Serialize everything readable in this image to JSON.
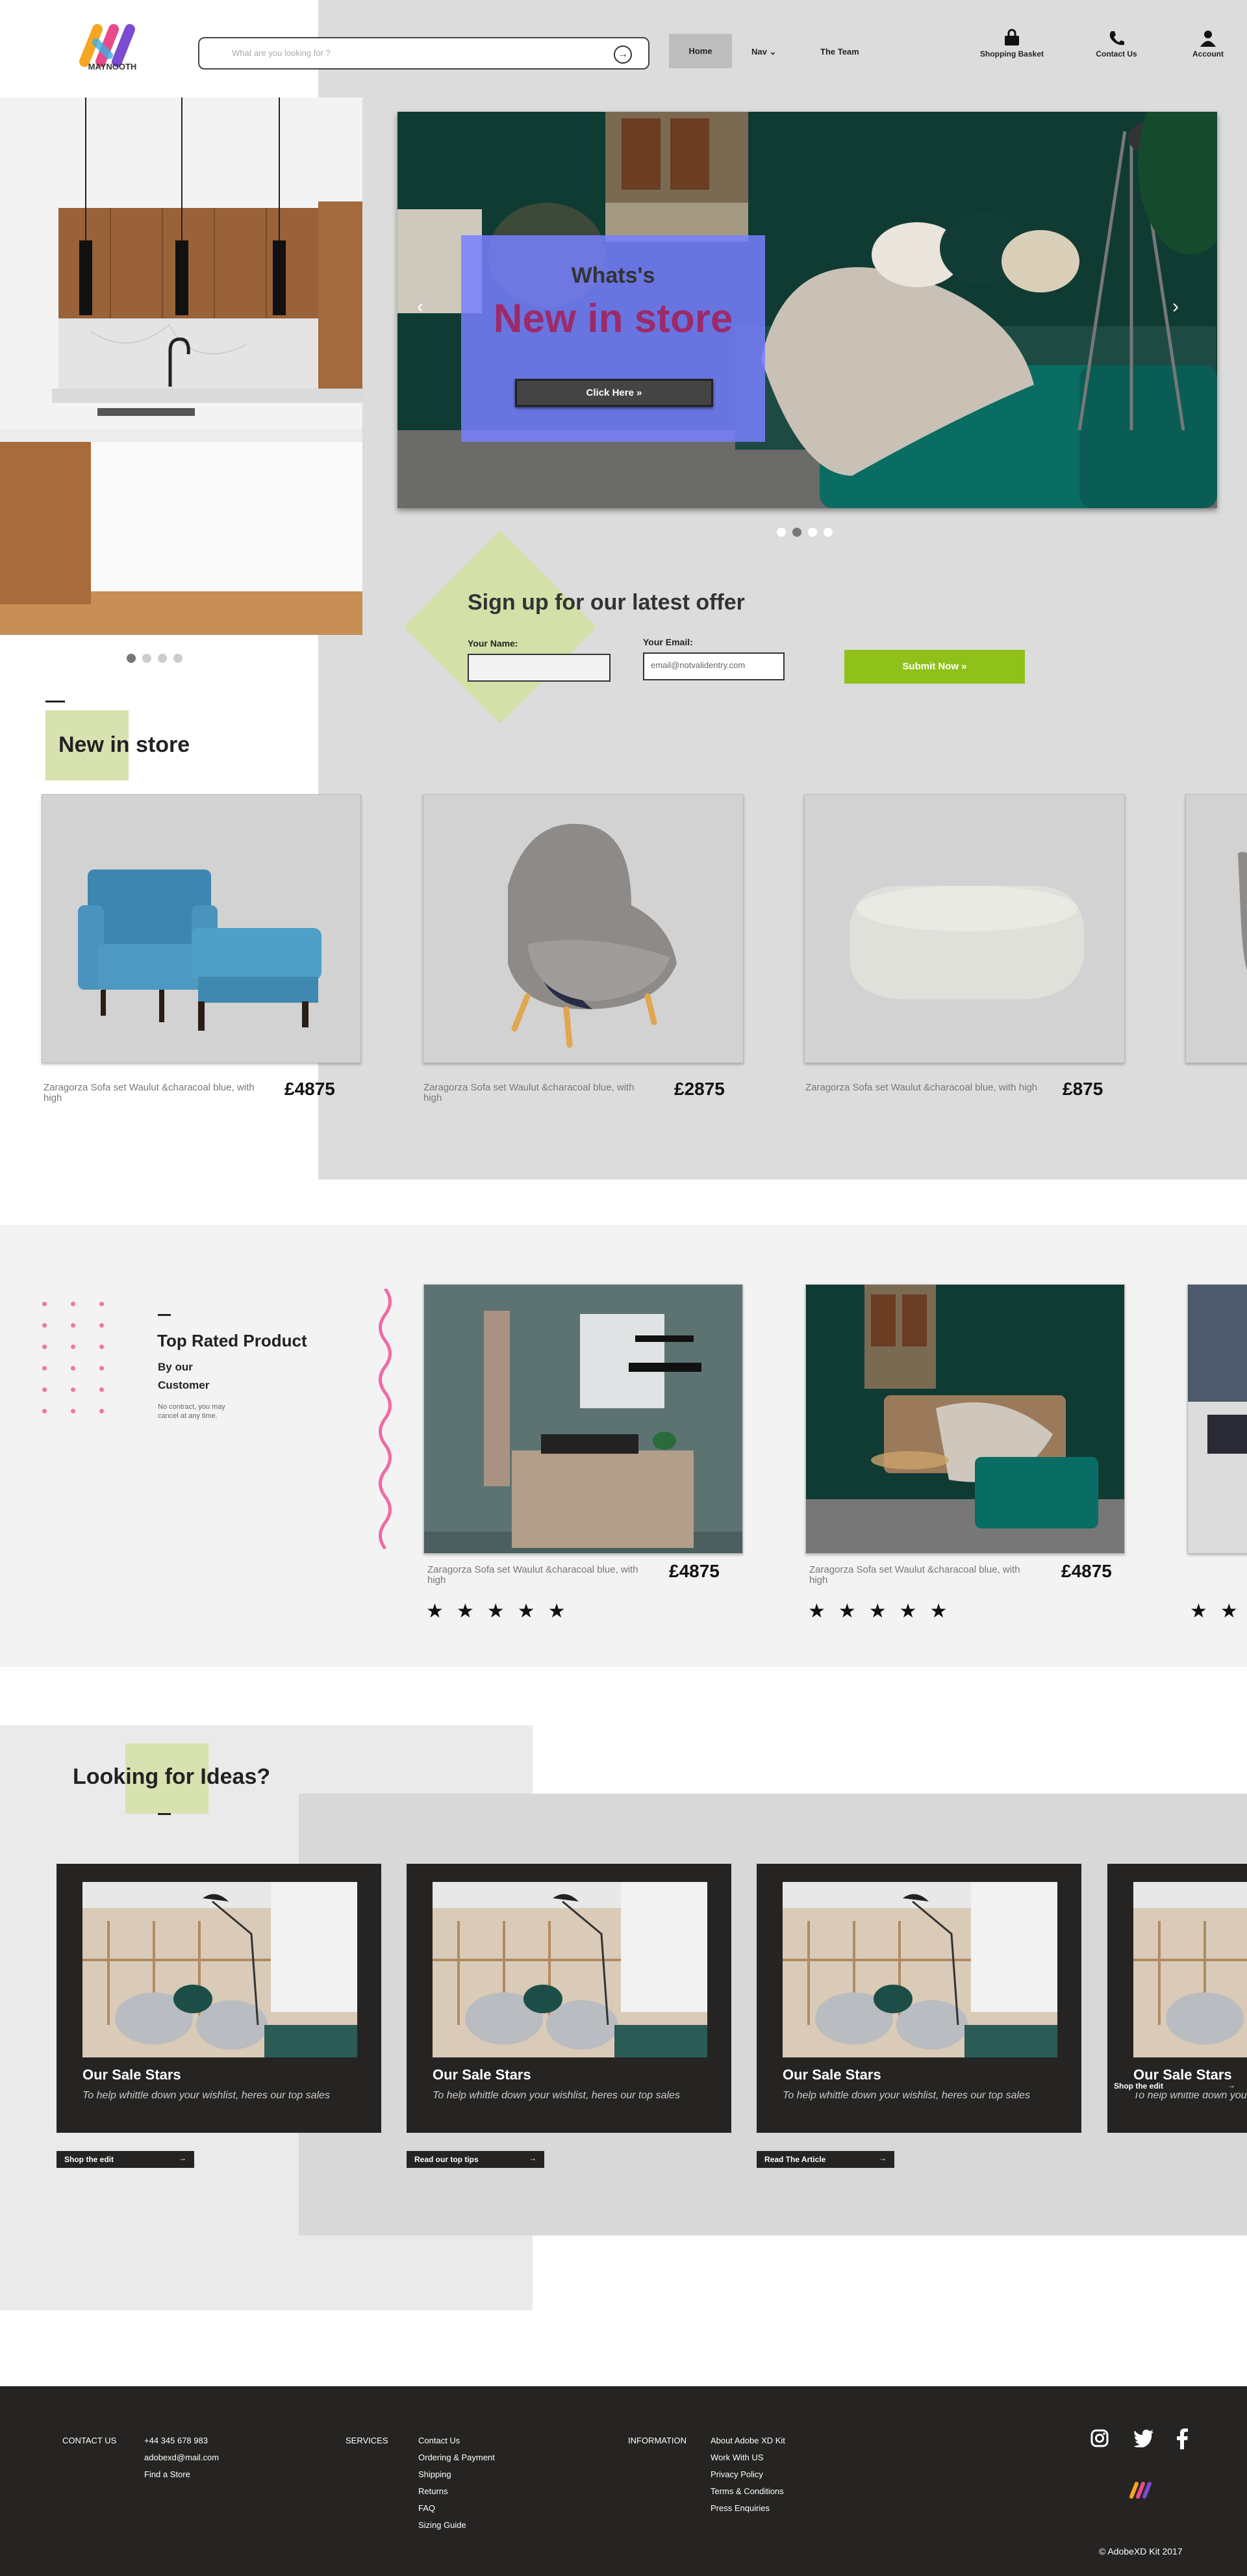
{
  "header": {
    "logo_text": "MAYNOOTH",
    "search_placeholder": "What are you looking for ?",
    "nav": {
      "home": "Home",
      "nav": "Nav",
      "team": "The Team"
    },
    "icons": [
      {
        "label": "Shopping Basket",
        "icon": "basket-icon"
      },
      {
        "label": "Contact Us",
        "icon": "phone-icon"
      },
      {
        "label": "Account",
        "icon": "account-icon"
      }
    ]
  },
  "hero": {
    "whats": "Whats's",
    "title": "New in store",
    "button": "Click Here  »",
    "slides": 4,
    "active_slide": 2
  },
  "kitchen_carousel": {
    "slides": 4,
    "active_slide": 1
  },
  "signup": {
    "title": "Sign up for our latest offer",
    "name_label": "Your Name:",
    "email_label": "Your Email:",
    "email_placeholder": "email@notvalidentry.com",
    "submit": "Submit Now »"
  },
  "new_in_store": {
    "title": "New in store",
    "products": [
      {
        "desc": "Zaragorza Sofa set Waulut &characoal blue, with high",
        "price": "£4875"
      },
      {
        "desc": "Zaragorza Sofa set Waulut &characoal blue, with high",
        "price": "£2875"
      },
      {
        "desc": "Zaragorza Sofa set Waulut &characoal blue, with high",
        "price": "£875"
      }
    ]
  },
  "top_rated": {
    "title": "Top Rated Product",
    "by": "By our",
    "customer": "Customer",
    "note": "No contract, you may cancel at any time.",
    "products": [
      {
        "desc": "Zaragorza Sofa set Waulut &characoal blue, with high",
        "price": "£4875",
        "stars": 5
      },
      {
        "desc": "Zaragorza Sofa set Waulut &characoal blue, with high",
        "price": "£4875",
        "stars": 5
      }
    ]
  },
  "ideas": {
    "title": "Looking for Ideas?",
    "cards": [
      {
        "title": "Our Sale Stars",
        "desc": "To help whittle down your wishlist, heres our top sales",
        "button": "Shop the edit"
      },
      {
        "title": "Our Sale Stars",
        "desc": "To help whittle down your wishlist, heres our top sales",
        "button": "Read our top tips"
      },
      {
        "title": "Our Sale Stars",
        "desc": "To help whittle down your wishlist, heres our top sales",
        "button": "Read The Article"
      },
      {
        "title": "Our Sale Stars",
        "desc": "To help whittle down your wishlist, heres our top sales",
        "button": "Shop the edit"
      }
    ]
  },
  "footer": {
    "contact_heading": "CONTACT US",
    "contact_items": [
      "+44 345 678 983",
      "adobexd@mail.com",
      "Find a Store"
    ],
    "services_heading": "SERVICES",
    "services_items": [
      "Contact Us",
      "Ordering & Payment",
      "Shipping",
      "Returns",
      "FAQ",
      "Sizing Guide"
    ],
    "info_heading": "INFORMATION",
    "info_items": [
      "About Adobe XD Kit",
      "Work With US",
      "Privacy Policy",
      "Terms & Conditions",
      "Press Enquiries"
    ],
    "copyright": "© AdobeXD Kit 2017"
  }
}
